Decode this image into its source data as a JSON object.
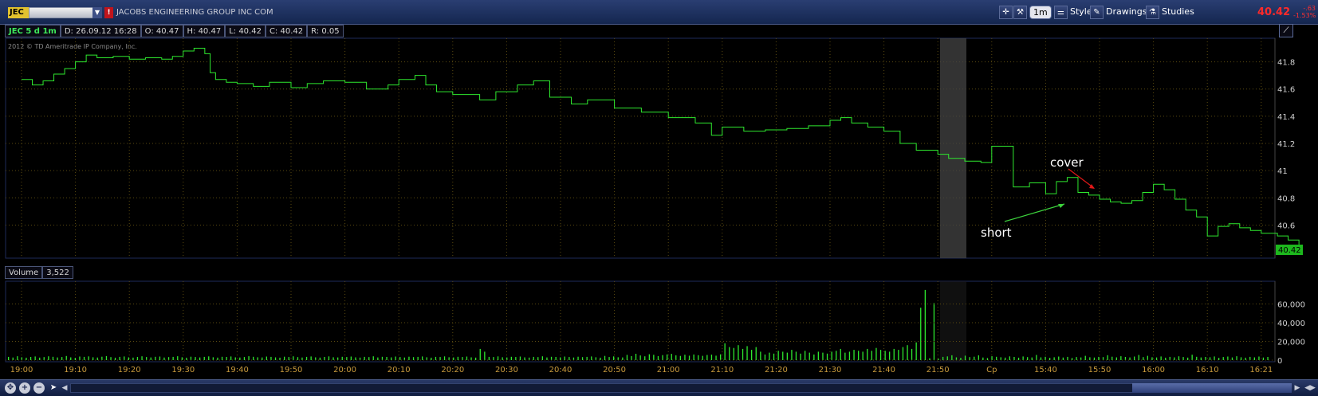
{
  "header": {
    "symbol": "JEC",
    "company": "JACOBS ENGINEERING GROUP INC COM",
    "last_price": "40.42",
    "change": "-.63",
    "change_pct": "-1.53%",
    "buttons": {
      "period": "1m",
      "style": "Style",
      "drawings": "Drawings",
      "studies": "Studies"
    },
    "icons": [
      "crosshair-icon",
      "wrench-icon",
      "style-icon",
      "pencil-icon",
      "studies-icon"
    ]
  },
  "infobar": {
    "title": "JEC 5 d 1m",
    "date": "D: 26.09.12 16:28",
    "open": "O: 40.47",
    "high": "H: 40.47",
    "low": "L: 40.42",
    "close": "C: 40.42",
    "range": "R: 0.05"
  },
  "copyright": "2012 © TD Ameritrade IP Company, Inc.",
  "volume_bar": {
    "label": "Volume",
    "value": "3,522"
  },
  "annotations": {
    "short": "short",
    "cover": "cover"
  },
  "colors": {
    "price_line": "#2ee82e",
    "annotation_short": "#3cd23c",
    "annotation_cover": "#e01818",
    "last_price": "#ff2a2a",
    "grid": "#5a4a10",
    "axis_text": "#c89a3c"
  },
  "chart_data": [
    {
      "type": "line",
      "title": "JEC 5 d 1m",
      "series": [
        {
          "name": "JEC",
          "x": [
            "19:00",
            "19:02",
            "19:04",
            "19:06",
            "19:08",
            "19:10",
            "19:12",
            "19:14",
            "19:17",
            "19:20",
            "19:23",
            "19:26",
            "19:28",
            "19:30",
            "19:32",
            "19:34",
            "19:35",
            "19:36",
            "19:38",
            "19:40",
            "19:43",
            "19:46",
            "19:50",
            "19:53",
            "19:56",
            "20:00",
            "20:04",
            "20:08",
            "20:10",
            "20:13",
            "20:15",
            "20:17",
            "20:20",
            "20:25",
            "20:28",
            "20:32",
            "20:35",
            "20:38",
            "20:42",
            "20:45",
            "20:50",
            "20:55",
            "21:00",
            "21:05",
            "21:08",
            "21:10",
            "21:14",
            "21:18",
            "21:22",
            "21:26",
            "21:30",
            "21:32",
            "21:34",
            "21:37",
            "21:40",
            "21:43",
            "21:46",
            "21:50",
            "21:52",
            "21:55",
            "21:58",
            "Cp",
            "15:34",
            "15:37",
            "15:40",
            "15:42",
            "15:44",
            "15:46",
            "15:48",
            "15:50",
            "15:52",
            "15:54",
            "15:56",
            "15:58",
            "16:00",
            "16:02",
            "16:04",
            "16:06",
            "16:08",
            "16:10",
            "16:12",
            "16:14",
            "16:16",
            "16:18",
            "16:21",
            "16:24",
            "16:26",
            "16:28"
          ],
          "values": [
            41.67,
            41.63,
            41.66,
            41.71,
            41.75,
            41.8,
            41.85,
            41.83,
            41.84,
            41.82,
            41.83,
            41.82,
            41.84,
            41.88,
            41.9,
            41.86,
            41.72,
            41.67,
            41.65,
            41.64,
            41.62,
            41.65,
            41.61,
            41.64,
            41.66,
            41.65,
            41.6,
            41.63,
            41.67,
            41.7,
            41.63,
            41.58,
            41.56,
            41.52,
            41.58,
            41.63,
            41.66,
            41.54,
            41.49,
            41.52,
            41.46,
            41.43,
            41.39,
            41.35,
            41.26,
            41.32,
            41.29,
            41.3,
            41.31,
            41.33,
            41.37,
            41.39,
            41.35,
            41.32,
            41.29,
            41.2,
            41.15,
            41.12,
            41.09,
            41.07,
            41.06,
            41.18,
            40.88,
            40.91,
            40.83,
            40.92,
            40.95,
            40.84,
            40.82,
            40.79,
            40.77,
            40.76,
            40.78,
            40.84,
            40.9,
            40.86,
            40.79,
            40.71,
            40.66,
            40.52,
            40.59,
            40.61,
            40.58,
            40.56,
            40.54,
            40.52,
            40.49,
            40.42
          ]
        }
      ],
      "x_tick_labels": [
        "19:00",
        "19:10",
        "19:20",
        "19:30",
        "19:40",
        "19:50",
        "20:00",
        "20:10",
        "20:20",
        "20:30",
        "20:40",
        "20:50",
        "21:00",
        "21:10",
        "21:20",
        "21:30",
        "21:40",
        "21:50",
        "Cp",
        "15:40",
        "15:50",
        "16:00",
        "16:10",
        "16:21"
      ],
      "y_tick_labels": [
        "41.8",
        "41.6",
        "41.4",
        "41.2",
        "41",
        "40.8",
        "40.6"
      ],
      "ylim": [
        40.38,
        41.95
      ],
      "current_value_label": "40.42",
      "grid": true
    },
    {
      "type": "bar",
      "title": "Volume",
      "values": [
        3500,
        2800,
        4200,
        3100,
        2600,
        3400,
        3900,
        2700,
        3200,
        4100,
        3600,
        2900,
        3300,
        4400,
        3000,
        2500,
        3800,
        3500,
        4000,
        3100,
        2800,
        3700,
        4300,
        3200,
        2600,
        3500,
        3900,
        3000,
        2700,
        3400,
        4100,
        3300,
        2900,
        3600,
        3800,
        2800,
        3200,
        3500,
        4200,
        3100,
        2600,
        3700,
        3300,
        2900,
        3500,
        4000,
        3100,
        2700,
        3600,
        3400,
        3900,
        3000,
        2800,
        3300,
        4200,
        3600,
        3100,
        2900,
        3800,
        3500,
        3000,
        2600,
        3700,
        3300,
        4100,
        3200,
        2800,
        3500,
        3900,
        3000,
        2700,
        3400,
        4000,
        3100,
        2900,
        3600,
        3300,
        3800,
        3000,
        2700,
        3500,
        3200,
        4100,
        2900,
        3600,
        3400,
        3000,
        3800,
        3300,
        2800,
        3700,
        3200,
        3500,
        3900,
        3100,
        2600,
        3500,
        3300,
        4000,
        3100,
        2900,
        3600,
        3300,
        3800,
        3000,
        2700,
        12000,
        9000,
        3500,
        3300,
        4000,
        3100,
        2900,
        3600,
        3300,
        3800,
        3000,
        2700,
        3500,
        3200,
        4100,
        2900,
        3600,
        3400,
        3000,
        3800,
        3300,
        2800,
        3700,
        3200,
        3500,
        3900,
        3100,
        2600,
        4500,
        3300,
        4000,
        3100,
        2900,
        5600,
        4300,
        6800,
        5000,
        4100,
        6300,
        5700,
        4300,
        5400,
        6100,
        6700,
        5100,
        4500,
        5800,
        4800,
        6000,
        5300,
        4600,
        5500,
        5900,
        4800,
        6200,
        18000,
        14000,
        13000,
        16000,
        12000,
        15000,
        11000,
        14000,
        9000,
        6000,
        8000,
        7000,
        10000,
        9000,
        8000,
        11000,
        9000,
        7000,
        10000,
        8000,
        6000,
        9000,
        8000,
        7000,
        9000,
        10000,
        12000,
        8000,
        9000,
        11000,
        10000,
        9000,
        12000,
        10000,
        13000,
        11000,
        10000,
        9000,
        12000,
        11000,
        14000,
        16000,
        12000,
        19000,
        56000,
        75000,
        2000,
        61000,
        1500,
        3500,
        4000,
        5200,
        3000,
        2500,
        4800,
        3200,
        3700,
        5100,
        2800,
        2300,
        4200,
        3600,
        3100,
        2700,
        4000,
        3400,
        2600,
        3900,
        3200,
        2900,
        5500,
        3000,
        3600,
        2500,
        3100,
        3800,
        2800,
        3500,
        2400,
        3300,
        2900,
        4600,
        3100,
        2800,
        3500,
        3200,
        5300,
        3700,
        3000,
        4200,
        3400,
        2900,
        3800,
        5500,
        3200,
        4600,
        3100,
        2900,
        3900,
        2600,
        3500,
        3000,
        4100,
        3300,
        2700,
        5800,
        3600,
        2900,
        3400,
        3100,
        3900,
        2500,
        3300,
        3800,
        2900,
        4200,
        3100,
        2600,
        3500,
        3000,
        3800,
        2800,
        3400
      ],
      "y_tick_labels": [
        "60,000",
        "40,000",
        "20,000",
        "0"
      ],
      "ylim": [
        0,
        80000
      ],
      "grid": true
    }
  ]
}
